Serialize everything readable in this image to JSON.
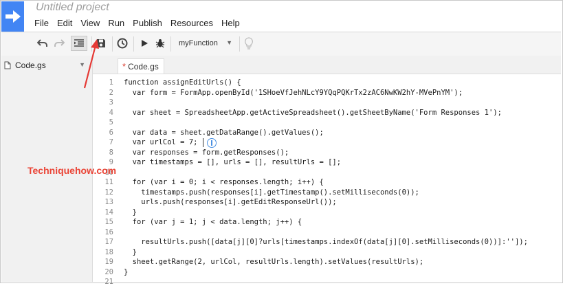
{
  "app": {
    "title": "Untitled project",
    "menu": [
      "File",
      "Edit",
      "View",
      "Run",
      "Publish",
      "Resources",
      "Help"
    ]
  },
  "toolbar": {
    "function_select": "myFunction",
    "icons": [
      "undo-icon",
      "redo-icon",
      "indent-icon",
      "save-icon",
      "triggers-icon",
      "run-icon",
      "debug-icon",
      "lightbulb-icon"
    ]
  },
  "sidebar": {
    "files": [
      {
        "name": "Code.gs"
      }
    ]
  },
  "editor": {
    "tab": {
      "label": "Code.gs",
      "modified_marker": "*"
    },
    "lines": [
      {
        "n": "1",
        "code": "function assignEditUrls() {"
      },
      {
        "n": "2",
        "code": "  var form = FormApp.openById('1SHoeVfJehNLcY9YQqPQKrTx2zAC6NwKW2hY-MVePnYM');"
      },
      {
        "n": "3",
        "code": ""
      },
      {
        "n": "4",
        "code": "  var sheet = SpreadsheetApp.getActiveSpreadsheet().getSheetByName('Form Responses 1');"
      },
      {
        "n": "5",
        "code": ""
      },
      {
        "n": "6",
        "code": "  var data = sheet.getDataRange().getValues();"
      },
      {
        "n": "7",
        "code": "  var urlCol = 7; "
      },
      {
        "n": "8",
        "code": "  var responses = form.getResponses();"
      },
      {
        "n": "9",
        "code": "  var timestamps = [], urls = [], resultUrls = [];"
      },
      {
        "n": "10",
        "code": ""
      },
      {
        "n": "11",
        "code": "  for (var i = 0; i < responses.length; i++) {"
      },
      {
        "n": "12",
        "code": "    timestamps.push(responses[i].getTimestamp().setMilliseconds(0));"
      },
      {
        "n": "13",
        "code": "    urls.push(responses[i].getEditResponseUrl());"
      },
      {
        "n": "14",
        "code": "  }"
      },
      {
        "n": "15",
        "code": "  for (var j = 1; j < data.length; j++) {"
      },
      {
        "n": "16",
        "code": ""
      },
      {
        "n": "17",
        "code": "    resultUrls.push([data[j][0]?urls[timestamps.indexOf(data[j][0].setMilliseconds(0))]:'']);"
      },
      {
        "n": "18",
        "code": "  }"
      },
      {
        "n": "19",
        "code": "  sheet.getRange(2, urlCol, resultUrls.length).setValues(resultUrls);"
      },
      {
        "n": "20",
        "code": "}"
      },
      {
        "n": "21",
        "code": ""
      }
    ]
  },
  "watermark": "Techniquehow.com",
  "colors": {
    "brand": "#4285f4",
    "watermark": "#ea4335",
    "modified": "#db4437",
    "arrow": "#e53935"
  }
}
